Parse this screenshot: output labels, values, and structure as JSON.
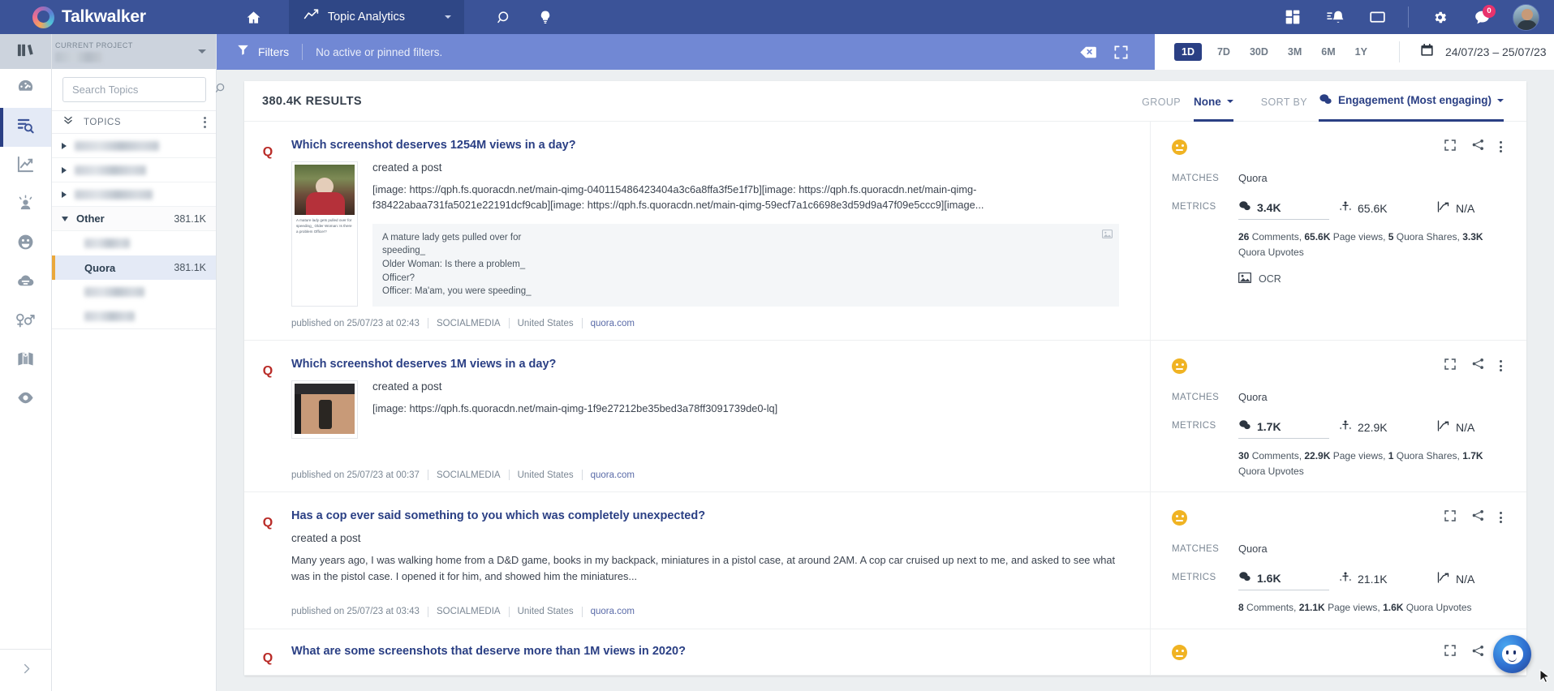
{
  "topnav": {
    "brand": "Talkwalker",
    "home_icon": "home-icon",
    "module": {
      "label": "Topic Analytics",
      "icon": "trend-chart-icon"
    },
    "search_icon": "search-icon",
    "bulb_icon": "lightbulb-icon",
    "right_icons": [
      "apps-grid-icon",
      "alerts-bell-icon",
      "monitor-icon",
      "settings-gear-icon",
      "messages-icon"
    ],
    "notification_count": "0"
  },
  "rail": {
    "items": [
      {
        "name": "projects-books-icon"
      },
      {
        "name": "dashboard-gauge-icon"
      },
      {
        "name": "results-search-icon",
        "active": true
      },
      {
        "name": "analytics-trend-icon"
      },
      {
        "name": "influencers-icon"
      },
      {
        "name": "sentiment-face-icon"
      },
      {
        "name": "topics-cloud-icon"
      },
      {
        "name": "demographics-icon"
      },
      {
        "name": "geography-map-icon"
      },
      {
        "name": "monitoring-eye-icon"
      }
    ],
    "collapse_icon": "chevron-right-icon"
  },
  "panel": {
    "project_label": "CURRENT PROJECT",
    "project_name": "",
    "search": {
      "placeholder": "Search Topics",
      "value": ""
    },
    "topics_header": "TOPICS",
    "rows": [
      {
        "type": "blurred",
        "expandable": true
      },
      {
        "type": "blurred",
        "expandable": true
      },
      {
        "type": "blurred",
        "expandable": true
      },
      {
        "type": "group",
        "label": "Other",
        "count": "381.1K",
        "expanded": true
      },
      {
        "type": "child-blurred"
      },
      {
        "type": "child",
        "label": "Quora",
        "count": "381.1K",
        "active": true
      },
      {
        "type": "child-blurred"
      },
      {
        "type": "child-blurred"
      }
    ]
  },
  "filterbar": {
    "filters_label": "Filters",
    "status": "No active or pinned filters.",
    "clear_icon": "clear-filters-icon",
    "expand_icon": "fullscreen-icon",
    "ranges": [
      "1D",
      "7D",
      "30D",
      "3M",
      "6M",
      "1Y"
    ],
    "active_range": "1D",
    "calendar_icon": "calendar-icon",
    "date_range": "24/07/23 – 25/07/23"
  },
  "results": {
    "count_label": "380.4K RESULTS",
    "group_label": "GROUP",
    "group_value": "None",
    "sort_label": "SORT BY",
    "sort_value": "Engagement (Most engaging)",
    "sort_icon": "engagement-bubble-icon",
    "matches_label": "MATCHES",
    "metrics_label": "METRICS",
    "items": [
      {
        "source_glyph": "Q",
        "title": "Which screenshot deserves 1254M views in a day?",
        "action": "created a post",
        "body": "[image: https://qph.fs.quoracdn.net/main-qimg-040115486423404a3c6a8ffa3f5e1f7b][image: https://qph.fs.quoracdn.net/main-qimg-f38422abaa731fa5021e22191dcf9cab][image: https://qph.fs.quoracdn.net/main-qimg-59ecf7a1c6698e3d59d9a47f09e5ccc9][image...",
        "thumb_caption": "A mature lady gets pulled over for speeding_ Older Woman: Is there a problem Officer?",
        "ocr_text": "A mature lady gets pulled over for\nspeeding_\nOlder Woman: Is there a problem_\nOfficer?\nOfficer: Ma'am, you were speeding_",
        "published": "published on 25/07/23 at 02:43",
        "media_type": "SOCIALMEDIA",
        "country": "United States",
        "domain": "quora.com",
        "sentiment": "neutral",
        "matches": "Quora",
        "metric_engagement": "3.4K",
        "metric_reach": "65.6K",
        "metric_trend": "N/A",
        "metrics_detail": [
          {
            "v": "26",
            "t": " Comments, "
          },
          {
            "v": "65.6K",
            "t": " Page views, "
          },
          {
            "v": "5",
            "t": " Quora Shares, "
          },
          {
            "v": "3.3K",
            "t": " Quora Upvotes"
          }
        ],
        "ocr_flag": "OCR"
      },
      {
        "source_glyph": "Q",
        "title": "Which screenshot deserves 1M views in a day?",
        "action": "created a post",
        "body": "[image: https://qph.fs.quoracdn.net/main-qimg-1f9e27212be35bed3a78ff3091739de0-lq]",
        "published": "published on 25/07/23 at 00:37",
        "media_type": "SOCIALMEDIA",
        "country": "United States",
        "domain": "quora.com",
        "sentiment": "neutral",
        "matches": "Quora",
        "metric_engagement": "1.7K",
        "metric_reach": "22.9K",
        "metric_trend": "N/A",
        "metrics_detail": [
          {
            "v": "30",
            "t": " Comments, "
          },
          {
            "v": "22.9K",
            "t": " Page views, "
          },
          {
            "v": "1",
            "t": " Quora Shares, "
          },
          {
            "v": "1.7K",
            "t": " Quora Upvotes"
          }
        ]
      },
      {
        "source_glyph": "Q",
        "title": "Has a cop ever said something to you which was completely unexpected?",
        "action": "created a post",
        "body": "Many years ago, I was walking home from a D&D game, books in my backpack, miniatures in a pistol case, at around 2AM. A cop car cruised up next to me, and asked to see what was in the pistol case. I opened it for him, and showed him the miniatures...",
        "published": "published on 25/07/23 at 03:43",
        "media_type": "SOCIALMEDIA",
        "country": "United States",
        "domain": "quora.com",
        "sentiment": "neutral",
        "matches": "Quora",
        "metric_engagement": "1.6K",
        "metric_reach": "21.1K",
        "metric_trend": "N/A",
        "metrics_detail": [
          {
            "v": "8",
            "t": " Comments, "
          },
          {
            "v": "21.1K",
            "t": " Page views, "
          },
          {
            "v": "1.6K",
            "t": " Quora Upvotes"
          }
        ]
      },
      {
        "source_glyph": "Q",
        "title": "What are some screenshots that deserve more than 1M views in 2020?",
        "sentiment": "neutral"
      }
    ]
  },
  "chat_widget": {
    "icon": "chat-assistant-icon"
  },
  "colors": {
    "topnav": "#3b5398",
    "filterbar": "#7188d4",
    "accent": "#2a3f84",
    "quora_red": "#b92b27",
    "sentiment_neutral": "#f0b323",
    "active_child_marker": "#eaa83c"
  }
}
